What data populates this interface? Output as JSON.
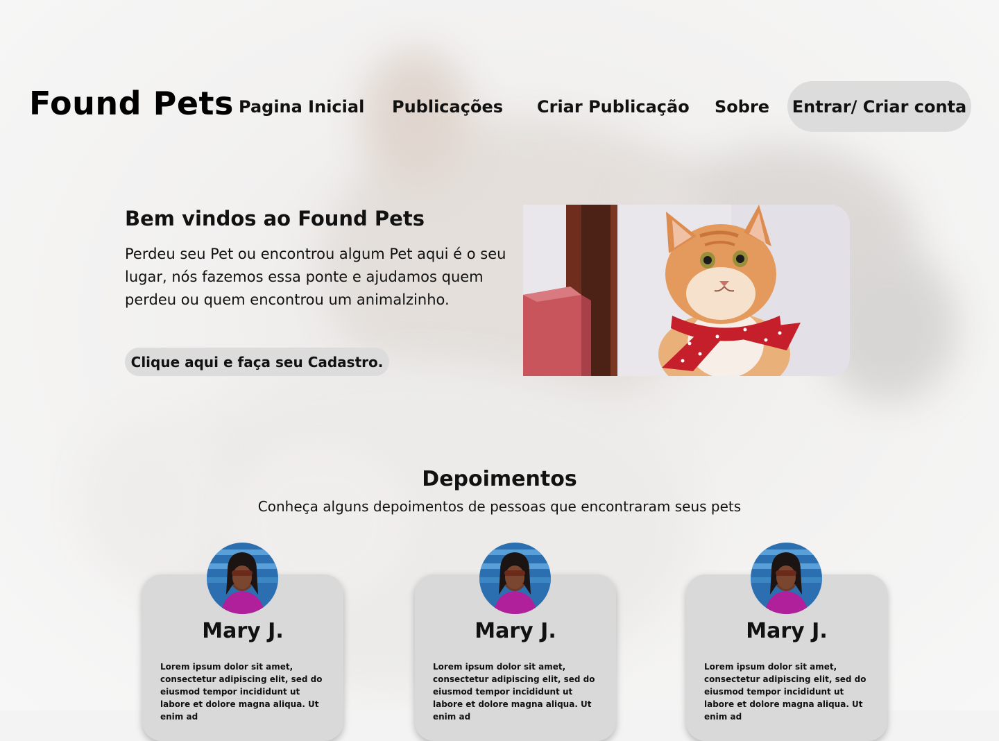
{
  "brand": {
    "name": "Found Pets"
  },
  "nav": {
    "items": [
      {
        "label": "Pagina Inicial"
      },
      {
        "label": "Publicações"
      },
      {
        "label": "Criar Publicação"
      },
      {
        "label": "Sobre"
      }
    ],
    "login_label": "Entrar/ Criar conta"
  },
  "hero": {
    "title": "Bem vindos ao Found Pets",
    "text": "Perdeu seu Pet ou encontrou algum Pet aqui é o seu lugar, nós fazemos essa ponte e ajudamos quem perdeu ou quem encontrou um animalzinho.",
    "cta_label": "Clique aqui e faça seu Cadastro.",
    "image_icon": "cat-with-red-bandana-photo"
  },
  "testimonials": {
    "title": "Depoimentos",
    "subtitle": "Conheça alguns depoimentos de pessoas que encontraram seus pets",
    "cards": [
      {
        "name": "Mary J.",
        "avatar_icon": "user-avatar-photo",
        "text": "Lorem ipsum dolor sit amet, consectetur adipiscing elit, sed do eiusmod tempor incididunt ut labore et dolore magna aliqua. Ut enim ad"
      },
      {
        "name": "Mary J.",
        "avatar_icon": "user-avatar-photo",
        "text": "Lorem ipsum dolor sit amet, consectetur adipiscing elit, sed do eiusmod tempor incididunt ut labore et dolore magna aliqua. Ut enim ad"
      },
      {
        "name": "Mary J.",
        "avatar_icon": "user-avatar-photo",
        "text": "Lorem ipsum dolor sit amet, consectetur adipiscing elit, sed do eiusmod tempor incididunt ut labore et dolore magna aliqua. Ut enim ad"
      }
    ]
  },
  "colors": {
    "button_bg": "#dcdcdc",
    "card_bg": "#d9d9d9",
    "text": "#111111"
  }
}
